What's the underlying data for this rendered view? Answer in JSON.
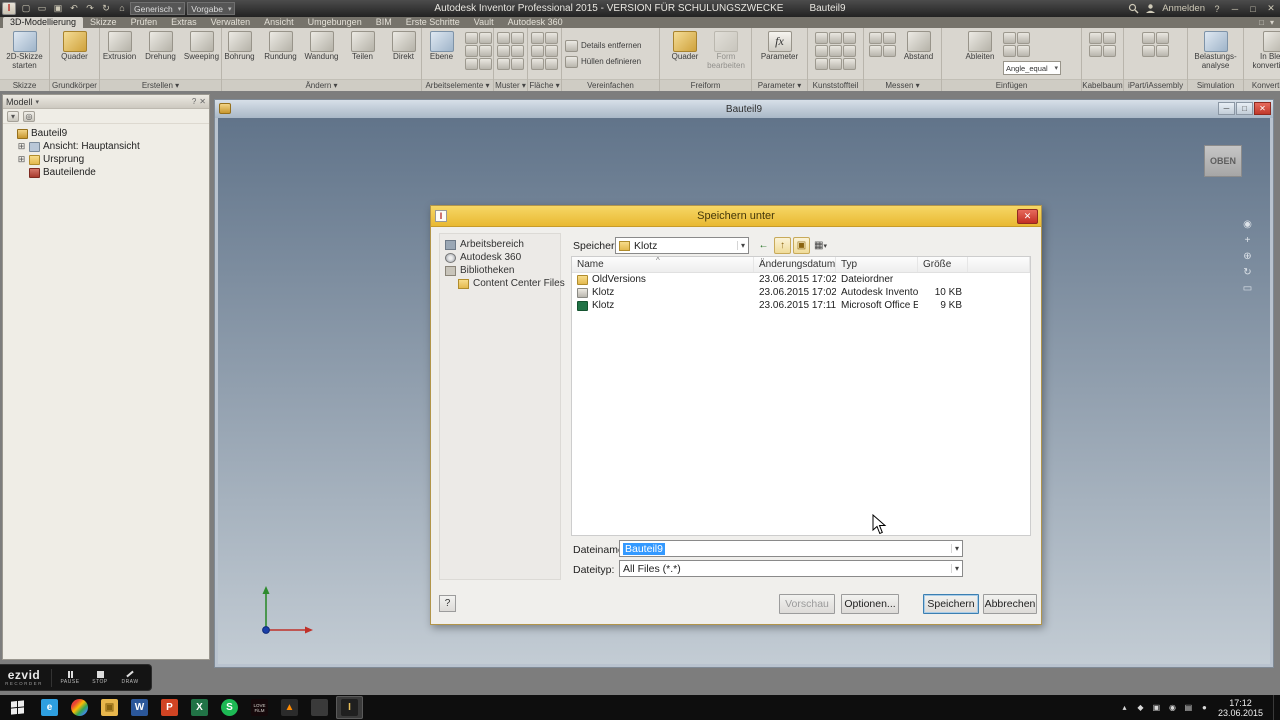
{
  "glyphs": {
    "chevron": "▾",
    "close": "✕",
    "minimize": "─",
    "maximize": "□",
    "help": "?",
    "back": "←",
    "up": "↑",
    "views": "▦",
    "new_folder": "▣",
    "sort": "^",
    "fx": "fx",
    "logo": "I"
  },
  "colors": {
    "selection": "#3399ff",
    "dialog_titlebar": "#edc243",
    "viewport_top": "#61748a",
    "viewport_bottom": "#c3ccd4",
    "taskbar": "#0e0e0e"
  },
  "titlebar": {
    "title": "Autodesk Inventor Professional 2015 - VERSION FÜR SCHULUNGSZWECKE",
    "doc": "Bauteil9",
    "signin": "Anmelden",
    "material": "Generisch",
    "appearance": "Vorgabe",
    "qat_icons": [
      "▢",
      "▭",
      "▣",
      "↶",
      "↷",
      "↻",
      "⌂"
    ]
  },
  "tabs": [
    {
      "label": "3D-Modellierung",
      "cls": "active"
    },
    {
      "label": "Skizze"
    },
    {
      "label": "Prüfen"
    },
    {
      "label": "Extras"
    },
    {
      "label": "Verwalten"
    },
    {
      "label": "Ansicht"
    },
    {
      "label": "Umgebungen"
    },
    {
      "label": "BIM"
    },
    {
      "label": "Erste Schritte"
    },
    {
      "label": "Vault"
    },
    {
      "label": "Autodesk 360"
    }
  ],
  "ribbon": {
    "groups": [
      {
        "label": "Skizze",
        "tools": [
          {
            "label": "2D-Skizze starten"
          }
        ]
      },
      {
        "label": "Grundkörper",
        "tools": [
          {
            "label": "Quader"
          }
        ]
      },
      {
        "label": "Erstellen ▾",
        "tools": [
          {
            "label": "Extrusion"
          },
          {
            "label": "Drehung"
          },
          {
            "label": "Sweeping"
          }
        ]
      },
      {
        "label": "Ändern ▾",
        "tools": [
          {
            "label": "Bohrung"
          },
          {
            "label": "Rundung"
          },
          {
            "label": "Wandung"
          },
          {
            "label": "Teilen"
          },
          {
            "label": "Direkt"
          }
        ]
      },
      {
        "label": "Arbeitselemente ▾",
        "tools": [
          {
            "label": "Ebene"
          }
        ]
      },
      {
        "label": "Muster ▾"
      },
      {
        "label": "Fläche ▾"
      },
      {
        "label": "Vereinfachen",
        "tools": [
          {
            "label": "Details entfernen"
          },
          {
            "label": "Hüllen definieren"
          }
        ]
      },
      {
        "label": "Freiform",
        "tools": [
          {
            "label": "Quader"
          },
          {
            "label": "Form bearbeiten"
          }
        ]
      },
      {
        "label": "Parameter ▾",
        "tools": [
          {
            "label": "Parameter"
          }
        ]
      },
      {
        "label": "Kunststoffteil"
      },
      {
        "label": "Messen ▾",
        "tools": [
          {
            "label": "Abstand"
          }
        ]
      },
      {
        "label": "Einfügen",
        "tools": [
          {
            "label": "Ableiten"
          }
        ],
        "combo": "Angle_equal"
      },
      {
        "label": "Kabelbaum"
      },
      {
        "label": "iPart/iAssembly"
      },
      {
        "label": "Simulation",
        "tools": [
          {
            "label": "Belastungs-analyse"
          }
        ]
      },
      {
        "label": "Konvertieren",
        "tools": [
          {
            "label": "In Blech konvertieren"
          }
        ]
      }
    ]
  },
  "browser": {
    "title": "Modell",
    "items": [
      {
        "label": "Bauteil9",
        "icon": "i-part",
        "exp": ""
      },
      {
        "label": "Ansicht: Hauptansicht",
        "icon": "i-view",
        "exp": "⊞",
        "cls": "lv1"
      },
      {
        "label": "Ursprung",
        "icon": "i-folder",
        "exp": "⊞",
        "cls": "lv1"
      },
      {
        "label": "Bauteilende",
        "icon": "i-end",
        "exp": "",
        "cls": "lv1"
      }
    ]
  },
  "document": {
    "title": "Bauteil9",
    "viewcube": "OBEN",
    "nav_icons": [
      "◉",
      "+",
      "⊕",
      "↻",
      "▭"
    ]
  },
  "dialog": {
    "title": "Speichern unter",
    "sidebar": [
      {
        "label": "Arbeitsbereich",
        "icon": "si-ws"
      },
      {
        "label": "Autodesk 360",
        "icon": "si-360"
      },
      {
        "label": "Bibliotheken",
        "icon": "si-lib"
      },
      {
        "label": "Content Center Files",
        "icon": "si-folder",
        "cls": "indent"
      }
    ],
    "location_label": "Speichern",
    "location_value": "Klotz",
    "columns": [
      "Name",
      "Änderungsdatum",
      "Typ",
      "Größe"
    ],
    "files": [
      {
        "name": "OldVersions",
        "date": "23.06.2015 17:02",
        "type": "Dateiordner",
        "size": "",
        "icon": "f-folder"
      },
      {
        "name": "Klotz",
        "date": "23.06.2015 17:02",
        "type": "Autodesk Inventor...",
        "size": "10 KB",
        "icon": "f-ipt"
      },
      {
        "name": "Klotz",
        "date": "23.06.2015 17:11",
        "type": "Microsoft Office E...",
        "size": "9 KB",
        "icon": "f-xls"
      }
    ],
    "filename_label": "Dateiname:",
    "filename_value": "Bauteil9",
    "filetype_label": "Dateityp:",
    "filetype_value": "All Files (*.*)",
    "help": "?",
    "buttons": {
      "vorschau": "Vorschau",
      "optionen": "Optionen...",
      "speichern": "Speichern",
      "abbrechen": "Abbrechen"
    }
  },
  "recorder": {
    "brand": "ezvid",
    "sub": "RECORDER",
    "pause": "PAUSE",
    "stop": "STOP",
    "draw": "DRAW"
  },
  "taskbar": {
    "apps": [
      {
        "name": "internet-explorer",
        "glyph": "e",
        "style": "background:#2e9fe0"
      },
      {
        "name": "chrome",
        "glyph": "",
        "style": "background:linear-gradient(135deg,#ea4335 25%,#fbbc05 45%,#34a853 65%,#4285f4 85%);border-radius:50%"
      },
      {
        "name": "file-explorer",
        "glyph": "▣",
        "style": "background:#e8b64c;color:#8a6410"
      },
      {
        "name": "word",
        "glyph": "W",
        "style": "background:#2b579a"
      },
      {
        "name": "powerpoint",
        "glyph": "P",
        "style": "background:#d04423"
      },
      {
        "name": "excel",
        "glyph": "X",
        "style": "background:#217346"
      },
      {
        "name": "spotify",
        "glyph": "S",
        "style": "background:#1db954;border-radius:50%;color:#fff"
      },
      {
        "name": "lovefilm",
        "glyph": "LOVE FiLM",
        "style": "background:#15080a;color:#d8d5cf;font-size:4.5px;line-height:5px;text-align:center;font-weight:normal"
      },
      {
        "name": "vlc",
        "glyph": "▲",
        "style": "background:#2b2b2b;color:#ff8a00"
      },
      {
        "name": "media",
        "glyph": "",
        "style": "background:#3a3a3a"
      },
      {
        "name": "inventor",
        "glyph": "I",
        "style": "background:#1f1f1f;color:#e8c05a",
        "cls": "active"
      }
    ],
    "tray": [
      "▴",
      "◆",
      "▣",
      "◉",
      "▤",
      "●"
    ],
    "time": "17:12",
    "date": "23.06.2015"
  }
}
